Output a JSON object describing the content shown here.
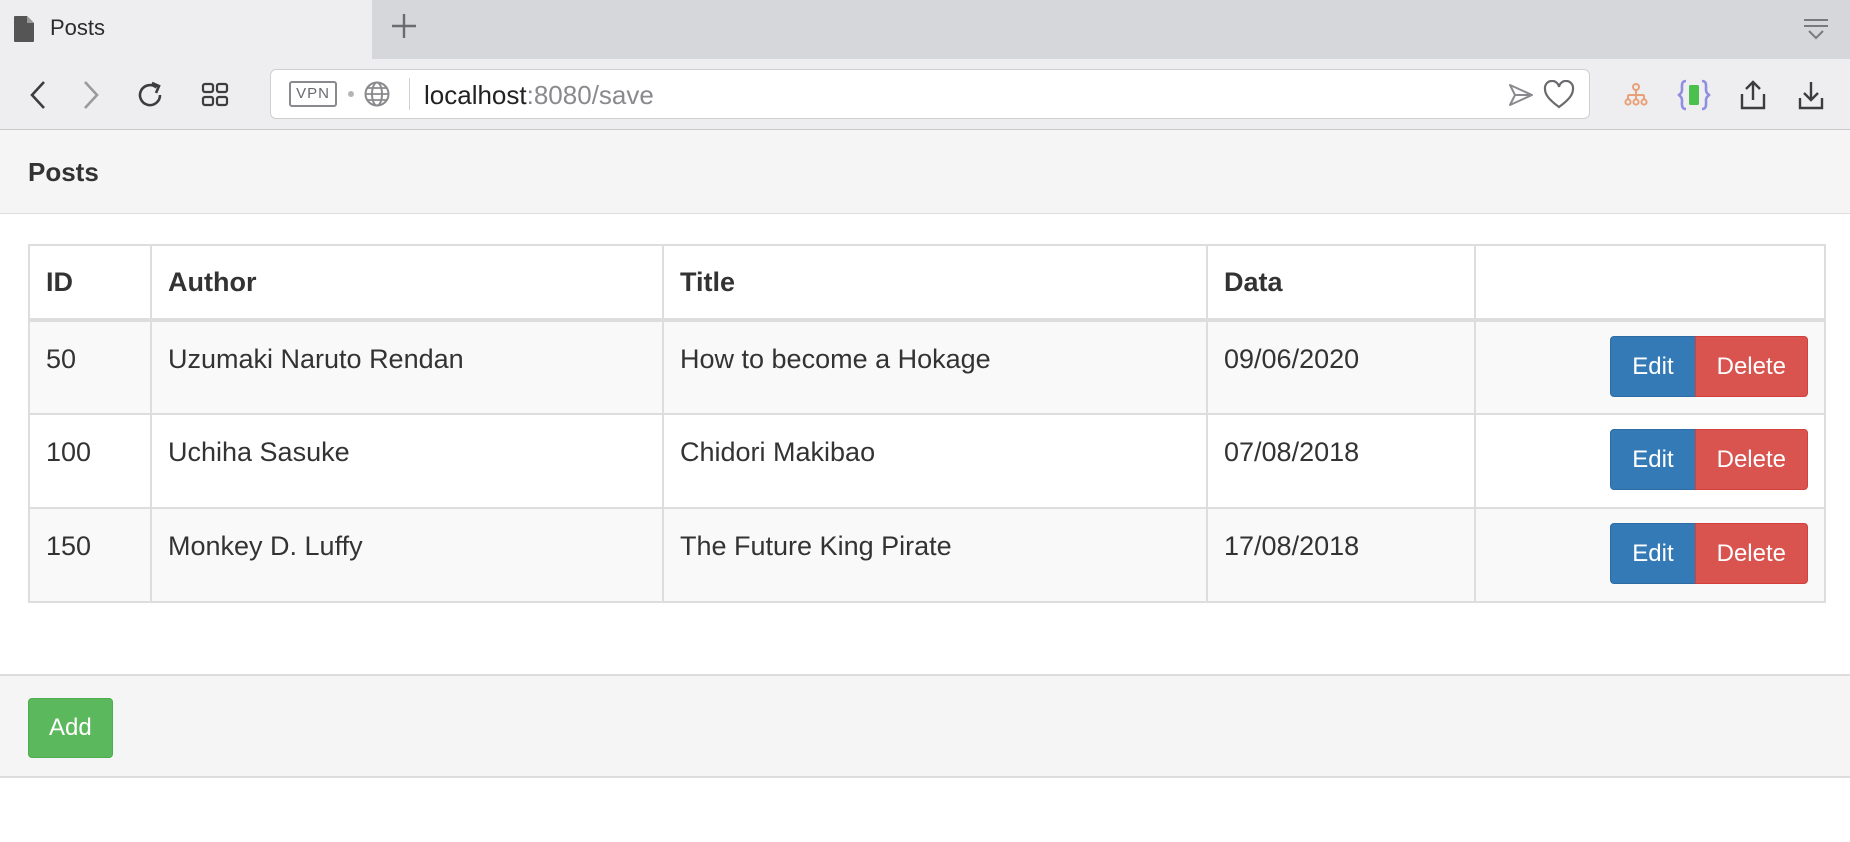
{
  "browser": {
    "tab_title": "Posts",
    "url_host": "localhost",
    "url_rest": ":8080/save",
    "vpn_label": "VPN",
    "icons": {
      "tab": "document-icon",
      "new_tab": "plus-icon",
      "tab_menu": "tab-menu-icon",
      "back": "chevron-left-icon",
      "forward": "chevron-right-icon",
      "reload": "reload-icon",
      "speed_dial": "grid-icon",
      "site": "globe-icon",
      "send": "send-icon",
      "bookmark": "heart-icon",
      "ext1": "sitemap-icon",
      "ext2": "braces-icon",
      "share": "share-icon",
      "downloads": "download-icon"
    }
  },
  "page": {
    "panel_title": "Posts",
    "columns": [
      "ID",
      "Author",
      "Title",
      "Data",
      ""
    ],
    "rows": [
      {
        "id": "50",
        "author": "Uzumaki Naruto Rendan",
        "title": "How to become a Hokage",
        "date": "09/06/2020"
      },
      {
        "id": "100",
        "author": "Uchiha Sasuke",
        "title": "Chidori Makibao",
        "date": "07/08/2018"
      },
      {
        "id": "150",
        "author": "Monkey D. Luffy",
        "title": "The Future King Pirate",
        "date": "17/08/2018"
      }
    ],
    "edit_label": "Edit",
    "delete_label": "Delete",
    "add_label": "Add",
    "colors": {
      "edit": "#337ab7",
      "delete": "#d9534f",
      "add": "#5cb85c"
    }
  }
}
